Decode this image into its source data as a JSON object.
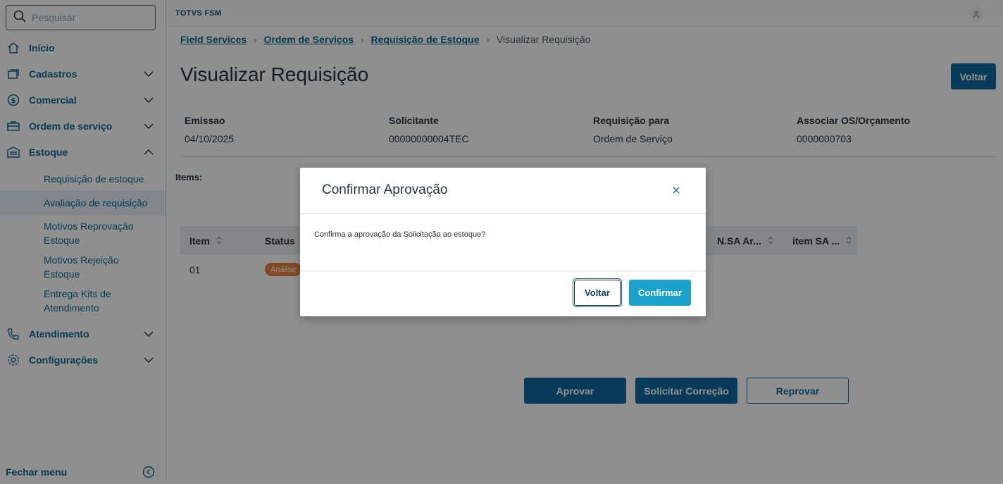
{
  "sidebar": {
    "search_placeholder": "Pesquisar",
    "items": [
      {
        "label": "Início",
        "icon": "home-icon"
      },
      {
        "label": "Cadastros",
        "icon": "cards-icon"
      },
      {
        "label": "Comercial",
        "icon": "dollar-icon"
      },
      {
        "label": "Ordem de serviço",
        "icon": "toolbox-icon"
      },
      {
        "label": "Estoque",
        "icon": "warehouse-icon"
      },
      {
        "label": "Atendimento",
        "icon": "phone-icon"
      },
      {
        "label": "Configurações",
        "icon": "gear-icon"
      }
    ],
    "estoque_sub": [
      "Requisição de estoque",
      "Avaliação de requisição",
      "Motivos Reprovação Estoque",
      "Motivos Rejeição Estoque",
      "Entrega Kits de Atendimento"
    ],
    "close_menu": "Fechar menu"
  },
  "topbar": {
    "brand": "TOTVS FSM"
  },
  "breadcrumb": {
    "items": [
      "Field Services",
      "Ordem de Serviços",
      "Requisição de Estoque"
    ],
    "current": "Visualizar Requisição"
  },
  "page": {
    "title": "Visualizar Requisição",
    "back_button": "Voltar",
    "fields": [
      {
        "label": "Emissao",
        "value": "04/10/2025"
      },
      {
        "label": "Solicitante",
        "value": "00000000004TEC"
      },
      {
        "label": "Requisição para",
        "value": "Ordem de Serviço"
      },
      {
        "label": "Associar OS/Orçamento",
        "value": "0000000703"
      }
    ],
    "items_label": "Items:",
    "table": {
      "headers": [
        "Item",
        "Status",
        "N.SA Ar...",
        "item SA ..."
      ],
      "row": {
        "item": "01",
        "status": "Análise"
      }
    },
    "actions": {
      "approve": "Aprovar",
      "request_correction": "Solicitar Correção",
      "reject": "Reprovar"
    }
  },
  "modal": {
    "title": "Confirmar Aprovação",
    "message": "Confirma a aprovação da Solicitação ao estoque?",
    "cancel": "Voltar",
    "confirm": "Confirmar"
  },
  "colors": {
    "accent": "#0c6c94",
    "primary_button": "#0f6ba0",
    "confirm_button": "#1aa1cc",
    "status_badge": "#e7853f"
  }
}
